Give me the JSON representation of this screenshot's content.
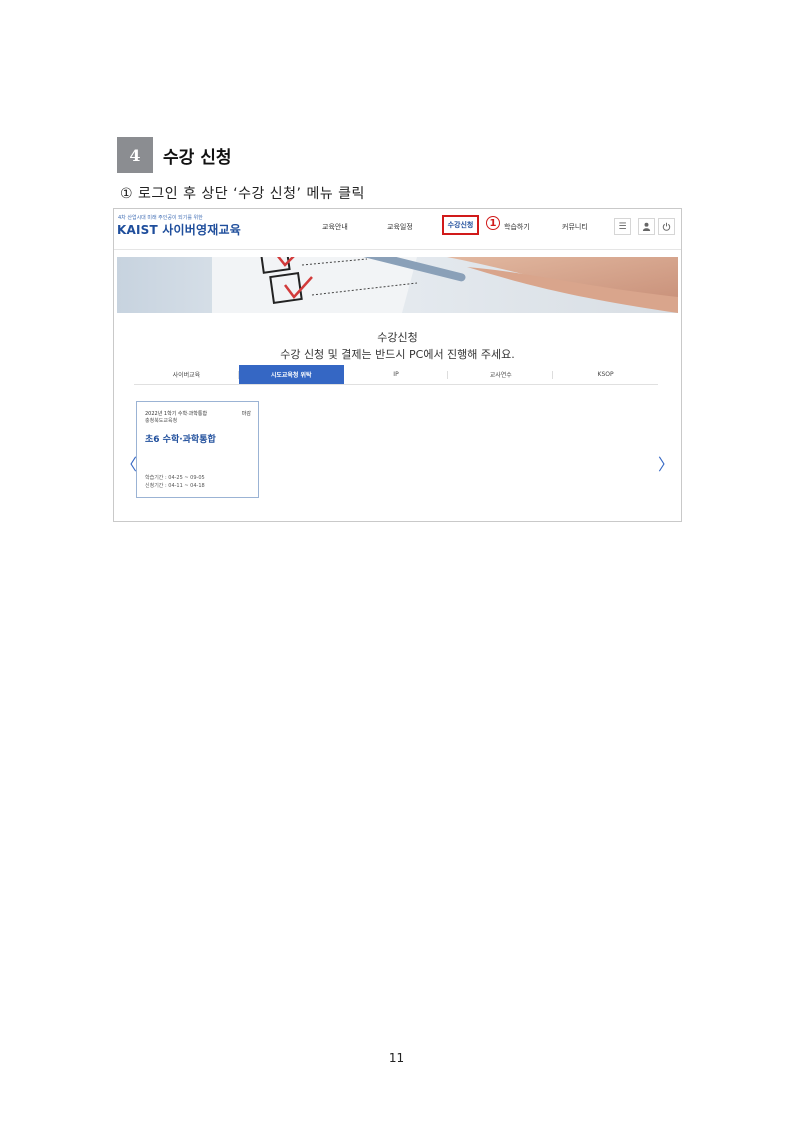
{
  "section": {
    "number": "4",
    "title": "수강 신청"
  },
  "step": {
    "text": "① 로그인 후 상단 ‘수강 신청’ 메뉴 클릭"
  },
  "screenshot": {
    "logo_sub": "4차 산업시대 미래 주인공이 되기를 위한",
    "logo_main": "KAIST 사이버영재교육",
    "nav": [
      "교육안내",
      "교육일정",
      "수강신청",
      "학습하기",
      "커뮤니티"
    ],
    "marker": "1",
    "icons": [
      "menu-icon",
      "user-icon",
      "power-icon"
    ],
    "page_title": "수강신청",
    "notice": "수강 신청 및 결제는 반드시 PC에서 진행해 주세요.",
    "tabs": [
      "사이버교육",
      "시도교육청 위탁",
      "IP",
      "교사연수",
      "KSOP"
    ],
    "active_tab_index": 1,
    "card": {
      "semester": "2022년 1학기 수학·과학통합",
      "status": "마감",
      "org": "충청북도교육청",
      "course": "초6 수학·과학통합",
      "study_period": "학습기간 : 04-25 ~ 09-05",
      "apply_period": "신청기간 : 04-11 ~ 04-18"
    },
    "colors": {
      "accent": "#3567c4",
      "highlight": "#d11a1a",
      "brand": "#1f4e9c"
    }
  },
  "page_number": "11"
}
